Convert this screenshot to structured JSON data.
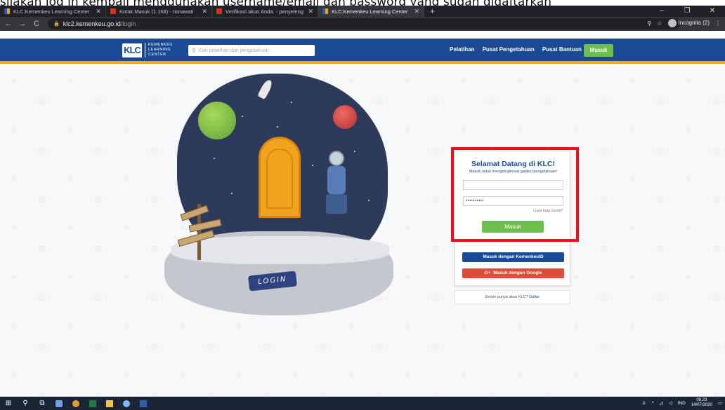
{
  "caption": "silakan log in kembali menggunakan username/email dan password yang sudah didaftarkan",
  "browser": {
    "tabs": [
      {
        "label": "KLC:Kemenkeu Learning Center",
        "favicon": "klc",
        "active": false
      },
      {
        "label": "Kotak Masuk (1.168) - risnawati",
        "favicon": "gmail",
        "active": false
      },
      {
        "label": "Verifikasi akun Anda. - penyeleng",
        "favicon": "gmail",
        "active": false
      },
      {
        "label": "KLC:Kemenkeu Learning Center",
        "favicon": "klc",
        "active": true
      }
    ],
    "url_host": "klc2.kemenkeu.go.id",
    "url_path": "/login",
    "incognito_label": "Incognito (2)"
  },
  "site": {
    "logo_mark": "KLC",
    "logo_lines": [
      "KEMENKEU",
      "LEARNING",
      "CENTER"
    ],
    "search_placeholder": "Cari pelatihan dan pengetahuan...",
    "nav": [
      "Pelatihan",
      "Pusat Pengetahuan",
      "Pusat Bantuan"
    ],
    "login_button": "Masuk"
  },
  "illustration": {
    "plaque_text": "LOGIN"
  },
  "login_card": {
    "title": "Selamat Datang di KLC!",
    "subtitle": "Masuk untuk mengeksplorasi galaksi pengetahuan!",
    "username_value": "",
    "password_value": "••••••••••",
    "forgot_link": "Lupa kata sandi?",
    "submit_label": "Masuk",
    "divider_text": "atau",
    "kemenkeuid_button": "Masuk dengan KemenkeuID",
    "google_button": "Masuk dengan Google",
    "google_icon": "G+"
  },
  "register": {
    "text": "Belum punya akun KLC?",
    "link": "Daftar"
  },
  "taskbar": {
    "language": "IND",
    "time": "08.23",
    "date": "14/07/2020"
  },
  "colors": {
    "brand_blue": "#1b4a95",
    "accent_green": "#6cc04a",
    "highlight_red": "#e8121a",
    "google_red": "#dd4b39",
    "accent_orange": "#f0a81f"
  }
}
